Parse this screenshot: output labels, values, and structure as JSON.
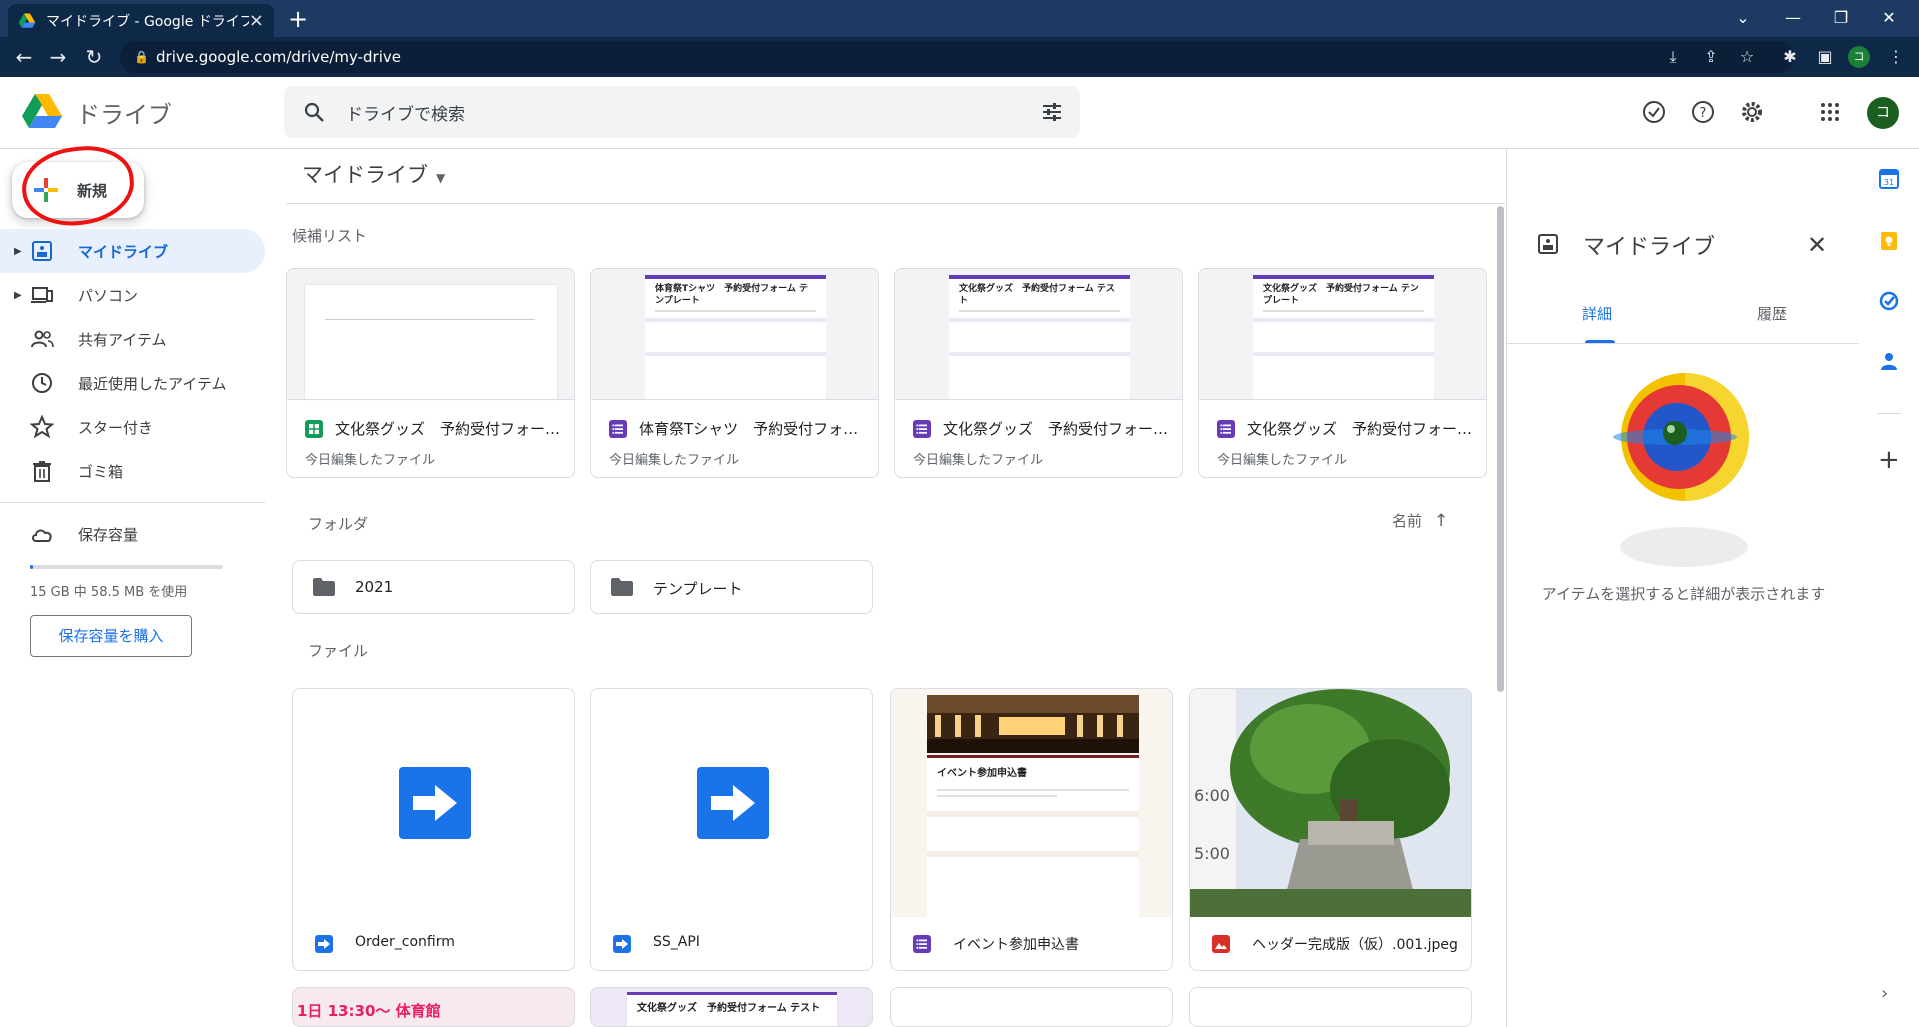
{
  "browser": {
    "tab_title": "マイドライブ - Google ドライブ",
    "url": "drive.google.com/drive/my-drive",
    "profile_initial": "コ"
  },
  "header": {
    "app_name": "ドライブ",
    "search_placeholder": "ドライブで検索",
    "avatar_initial": "コ"
  },
  "sidebar": {
    "new_label": "新規",
    "items": [
      {
        "label": "マイドライブ"
      },
      {
        "label": "パソコン"
      },
      {
        "label": "共有アイテム"
      },
      {
        "label": "最近使用したアイテム"
      },
      {
        "label": "スター付き"
      },
      {
        "label": "ゴミ箱"
      },
      {
        "label": "保存容量"
      }
    ],
    "storage_used_fraction": 0.004,
    "storage_text": "15 GB 中 58.5 MB を使用",
    "buy_storage_label": "保存容量を購入"
  },
  "main": {
    "breadcrumb": "マイドライブ",
    "suggested_title": "候補リスト",
    "suggested": [
      {
        "name": "文化祭グッズ　予約受付フォー…",
        "sub": "今日編集したファイル",
        "type": "sheets"
      },
      {
        "name": "体育祭Tシャツ　予約受付フォー…",
        "sub": "今日編集したファイル",
        "type": "forms",
        "thumb_title": "体育祭Tシャツ　予約受付フォーム テンプレート"
      },
      {
        "name": "文化祭グッズ　予約受付フォー…",
        "sub": "今日編集したファイル",
        "type": "forms",
        "thumb_title": "文化祭グッズ　予約受付フォーム テスト"
      },
      {
        "name": "文化祭グッズ　予約受付フォー…",
        "sub": "今日編集したファイル",
        "type": "forms",
        "thumb_title": "文化祭グッズ　予約受付フォーム テンプレート"
      }
    ],
    "folders_title": "フォルダ",
    "sort_label": "名前",
    "folders": [
      {
        "name": "2021"
      },
      {
        "name": "テンプレート"
      }
    ],
    "files_title": "ファイル",
    "files": [
      {
        "name": "Order_confirm",
        "type": "script"
      },
      {
        "name": "SS_API",
        "type": "script"
      },
      {
        "name": "イベント参加申込書",
        "type": "forms",
        "thumb_title": "イベント参加申込書"
      },
      {
        "name": "ヘッダー完成版（仮）.001.jpeg",
        "type": "image"
      }
    ],
    "bottom_thumbs": {
      "first_text": "1日 13:30〜 体育館",
      "second_title": "文化祭グッズ　予約受付フォーム テスト"
    }
  },
  "details": {
    "title": "マイドライブ",
    "tab_details": "詳細",
    "tab_history": "履歴",
    "empty_message": "アイテムを選択すると詳細が表示されます"
  },
  "colors": {
    "accent": "#1a73e8",
    "forms": "#673ab7",
    "sheets": "#0f9d58",
    "image": "#d93025",
    "annotation": "#e11111"
  }
}
